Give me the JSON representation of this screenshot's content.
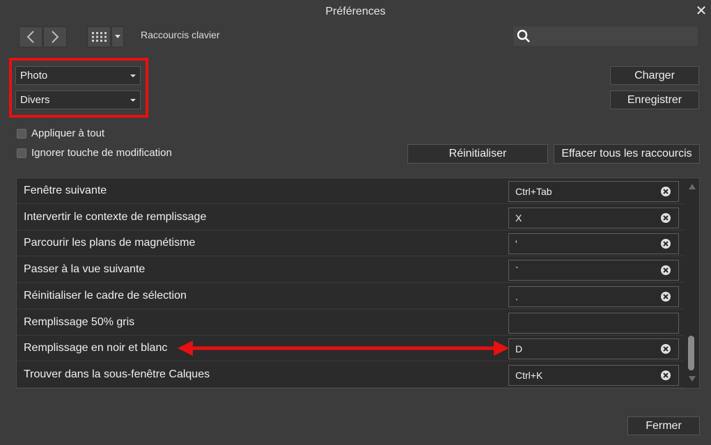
{
  "window": {
    "title": "Préférences",
    "close_glyph": "✕"
  },
  "toolbar": {
    "back_icon": "chevron-left-icon",
    "forward_icon": "chevron-right-icon",
    "grid_icon": "grid-icon",
    "section": "Raccourcis clavier",
    "search_placeholder": ""
  },
  "selectors": {
    "app": "Photo",
    "category": "Divers"
  },
  "buttons": {
    "load": "Charger",
    "save": "Enregistrer",
    "reset": "Réinitialiser",
    "clear_all": "Effacer tous les raccourcis",
    "close": "Fermer"
  },
  "options": {
    "apply_all": "Appliquer à tout",
    "ignore_modifier": "Ignorer touche de modification"
  },
  "shortcuts": [
    {
      "label": "Fenêtre suivante",
      "key": "Ctrl+Tab",
      "clear": true
    },
    {
      "label": "Intervertir le contexte de remplissage",
      "key": "X",
      "clear": true
    },
    {
      "label": "Parcourir les plans de magnétisme",
      "key": "'",
      "clear": true
    },
    {
      "label": "Passer à la vue suivante",
      "key": "`",
      "clear": true
    },
    {
      "label": "Réinitialiser le cadre de sélection",
      "key": ".",
      "clear": true
    },
    {
      "label": "Remplissage 50% gris",
      "key": "",
      "clear": false
    },
    {
      "label": "Remplissage en noir et blanc",
      "key": "D",
      "clear": true
    },
    {
      "label": "Trouver dans la sous-fenêtre Calques",
      "key": "Ctrl+K",
      "clear": true
    }
  ],
  "colors": {
    "highlight_red": "#e81010",
    "background": "#3c3c3c",
    "list_bg": "#2b2b2b"
  }
}
